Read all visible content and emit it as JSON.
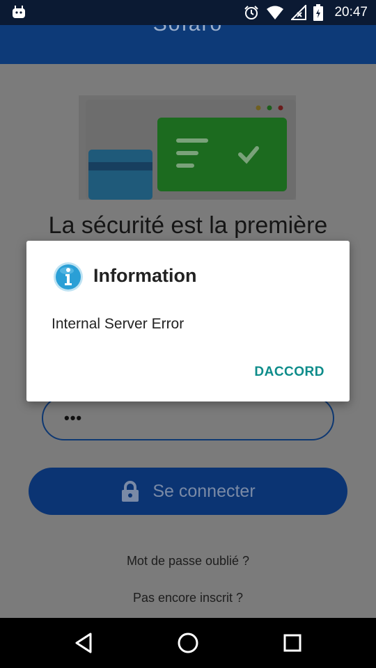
{
  "status_bar": {
    "time": "20:47",
    "icons": [
      "android-debug-icon",
      "alarm-icon",
      "wifi-icon",
      "no-signal-icon",
      "battery-icon"
    ]
  },
  "app_bar": {
    "title": "Sofaro"
  },
  "page": {
    "headline": "La sécurité est la première",
    "password_value": "•••",
    "login_button_label": "Se connecter",
    "forgot_password_label": "Mot de passe oublié ?",
    "register_label": "Pas encore inscrit ?"
  },
  "dialog": {
    "title": "Information",
    "message": "Internal Server Error",
    "ok_label": "DACCORD"
  },
  "navigation": {
    "icons": [
      "back-icon",
      "home-icon",
      "recents-icon"
    ]
  },
  "colors": {
    "app_bar": "#0d3a78",
    "accent_button_text": "#0d8c8a",
    "info_icon": "#2a9fd6"
  }
}
